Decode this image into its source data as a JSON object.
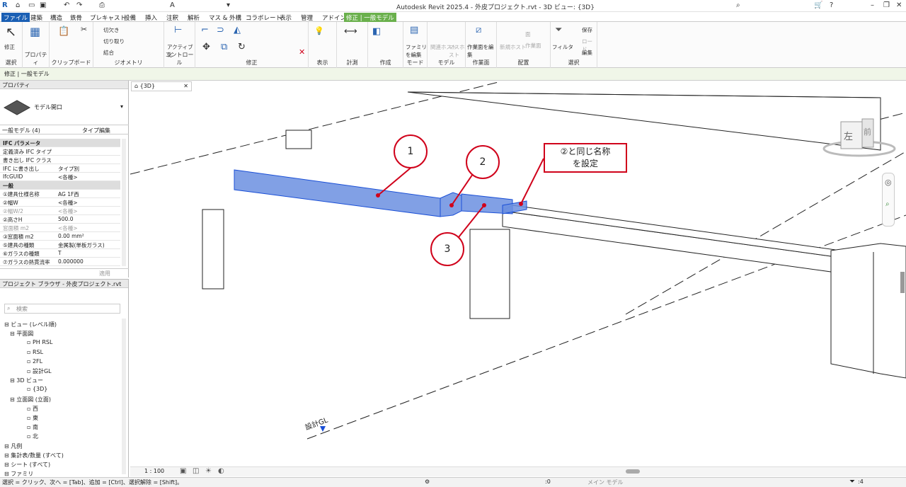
{
  "window": {
    "title": "Autodesk Revit 2025.4 - 外皮プロジェクト.rvt - 3D ビュー: {3D}"
  },
  "tabs": [
    "ファイル",
    "建築",
    "構造",
    "鉄骨",
    "プレキャスト",
    "設備",
    "挿入",
    "注釈",
    "解析",
    "マス & 外構",
    "コラボレート",
    "表示",
    "管理",
    "アドイン",
    "修正 | 一般モデル"
  ],
  "ribbon": {
    "panels": [
      "選択",
      "プロパティ",
      "クリップボード",
      "ジオメトリ",
      "コントロール",
      "修正",
      "表示",
      "計測",
      "作成",
      "モード",
      "モデル",
      "作業面",
      "配置",
      "選択"
    ],
    "modify": "修正",
    "cut": "切欠き",
    "cut2": "切り取り",
    "join": "結合",
    "activate": "アクティブ化",
    "family_edit": "ファミリを編集",
    "link_host": "関連ホスト",
    "mass_host": "マスホスト",
    "work_plane": "作業面を編集",
    "new_host": "新規ホスト",
    "face": "面",
    "work_plane2": "作業面",
    "filter": "フィルタ",
    "save": "保存",
    "load": "ロード",
    "edit": "編集"
  },
  "optbar": "修正 | 一般モデル",
  "properties": {
    "header": "プロパティ",
    "type_name": "モデル開口",
    "selector": "一般モデル (4)",
    "edit_type": "タイプ編集",
    "rows": [
      {
        "k": "IFC パラメータ",
        "v": "",
        "grp": true
      },
      {
        "k": "定義済み IFC タイプ",
        "v": ""
      },
      {
        "k": "書き出し IFC クラス",
        "v": ""
      },
      {
        "k": "IFC に書き出し",
        "v": "タイプ別"
      },
      {
        "k": "IfcGUID",
        "v": "<各種>"
      },
      {
        "k": "一般",
        "v": "",
        "grp": true
      },
      {
        "k": "①建具仕様名称",
        "v": "AG 1F西"
      },
      {
        "k": "②幅W",
        "v": "<各種>"
      },
      {
        "k": "②幅W/2",
        "v": "<各種>",
        "dim": true
      },
      {
        "k": "②高さH",
        "v": "500.0"
      },
      {
        "k": "窓面積 m2",
        "v": "<各種>",
        "dim": true
      },
      {
        "k": "③窓面積 m2",
        "v": "0.00 mm²"
      },
      {
        "k": "⑤建具の種類",
        "v": "金属製(単板ガラス)"
      },
      {
        "k": "⑥ガラスの種類",
        "v": "T"
      },
      {
        "k": "⑦ガラスの熱貫流率",
        "v": "0.000000"
      }
    ],
    "apply": "適用"
  },
  "browser": {
    "header": "プロジェクト ブラウザ - 外皮プロジェクト.rvt",
    "search": "検索",
    "items": [
      {
        "t": "ビュー (レベル順)",
        "x": 6
      },
      {
        "t": "平面図",
        "x": 14
      },
      {
        "t": "PH RSL",
        "x": 38
      },
      {
        "t": "RSL",
        "x": 38
      },
      {
        "t": "2FL",
        "x": 38
      },
      {
        "t": "設計GL",
        "x": 38
      },
      {
        "t": "3D ビュー",
        "x": 14
      },
      {
        "t": "{3D}",
        "x": 38
      },
      {
        "t": "立面図 (立面)",
        "x": 14
      },
      {
        "t": "西",
        "x": 38
      },
      {
        "t": "東",
        "x": 38
      },
      {
        "t": "南",
        "x": 38
      },
      {
        "t": "北",
        "x": 38
      },
      {
        "t": "凡例",
        "x": 6
      },
      {
        "t": "集計表/数量 (すべて)",
        "x": 6
      },
      {
        "t": "シート (すべて)",
        "x": 6
      },
      {
        "t": "ファミリ",
        "x": 6
      }
    ]
  },
  "view": {
    "tab": "{3D}",
    "level_label": "設計GL",
    "viewcube_face": "左",
    "viewcube_face2": "前",
    "callouts": [
      "1",
      "2",
      "3"
    ],
    "note": "②と同じ名称\nを設定"
  },
  "viewctrl": {
    "scale": "1 : 100"
  },
  "status": {
    "text": "選択 = クリック、次へ = [Tab]、追加 = [Ctrl]、選択解除 = [Shift]。",
    "count": ":0",
    "model": "メイン モデル",
    "filter_count": ":4"
  }
}
